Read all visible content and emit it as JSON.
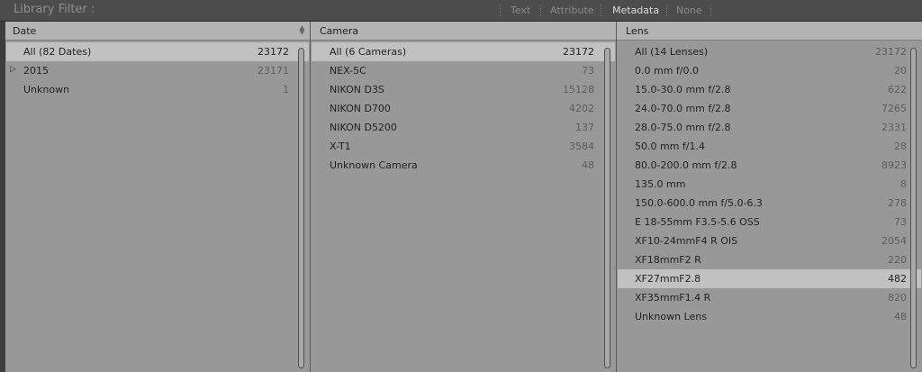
{
  "filter_bar": {
    "title": "Library Filter :",
    "modes": [
      {
        "label": "Text",
        "active": false
      },
      {
        "label": "Attribute",
        "active": false
      },
      {
        "label": "Metadata",
        "active": true
      },
      {
        "label": "None",
        "active": false
      }
    ]
  },
  "columns": [
    {
      "header": "Date",
      "rows": [
        {
          "label": "All (82 Dates)",
          "count": "23172",
          "selected": true
        },
        {
          "label": "2015",
          "count": "23171",
          "expandable": true
        },
        {
          "label": "Unknown",
          "count": "1"
        }
      ]
    },
    {
      "header": "Camera",
      "rows": [
        {
          "label": "All (6 Cameras)",
          "count": "23172",
          "selected": true
        },
        {
          "label": "NEX-5C",
          "count": "73"
        },
        {
          "label": "NIKON D3S",
          "count": "15128"
        },
        {
          "label": "NIKON D700",
          "count": "4202"
        },
        {
          "label": "NIKON D5200",
          "count": "137"
        },
        {
          "label": "X-T1",
          "count": "3584"
        },
        {
          "label": "Unknown Camera",
          "count": "48"
        }
      ]
    },
    {
      "header": "Lens",
      "rows": [
        {
          "label": "All (14 Lenses)",
          "count": "23172"
        },
        {
          "label": "0.0 mm f/0.0",
          "count": "20"
        },
        {
          "label": "15.0-30.0 mm f/2.8",
          "count": "622"
        },
        {
          "label": "24.0-70.0 mm f/2.8",
          "count": "7265"
        },
        {
          "label": "28.0-75.0 mm f/2.8",
          "count": "2331"
        },
        {
          "label": "50.0 mm f/1.4",
          "count": "28"
        },
        {
          "label": "80.0-200.0 mm f/2.8",
          "count": "8923"
        },
        {
          "label": "135.0 mm",
          "count": "8"
        },
        {
          "label": "150.0-600.0 mm f/5.0-6.3",
          "count": "278"
        },
        {
          "label": "E 18-55mm F3.5-5.6 OSS",
          "count": "73"
        },
        {
          "label": "XF10-24mmF4 R OIS",
          "count": "2054"
        },
        {
          "label": "XF18mmF2 R",
          "count": "220"
        },
        {
          "label": "XF27mmF2.8",
          "count": "482",
          "selected": true
        },
        {
          "label": "XF35mmF1.4 R",
          "count": "820"
        },
        {
          "label": "Unknown Lens",
          "count": "48"
        }
      ]
    }
  ]
}
